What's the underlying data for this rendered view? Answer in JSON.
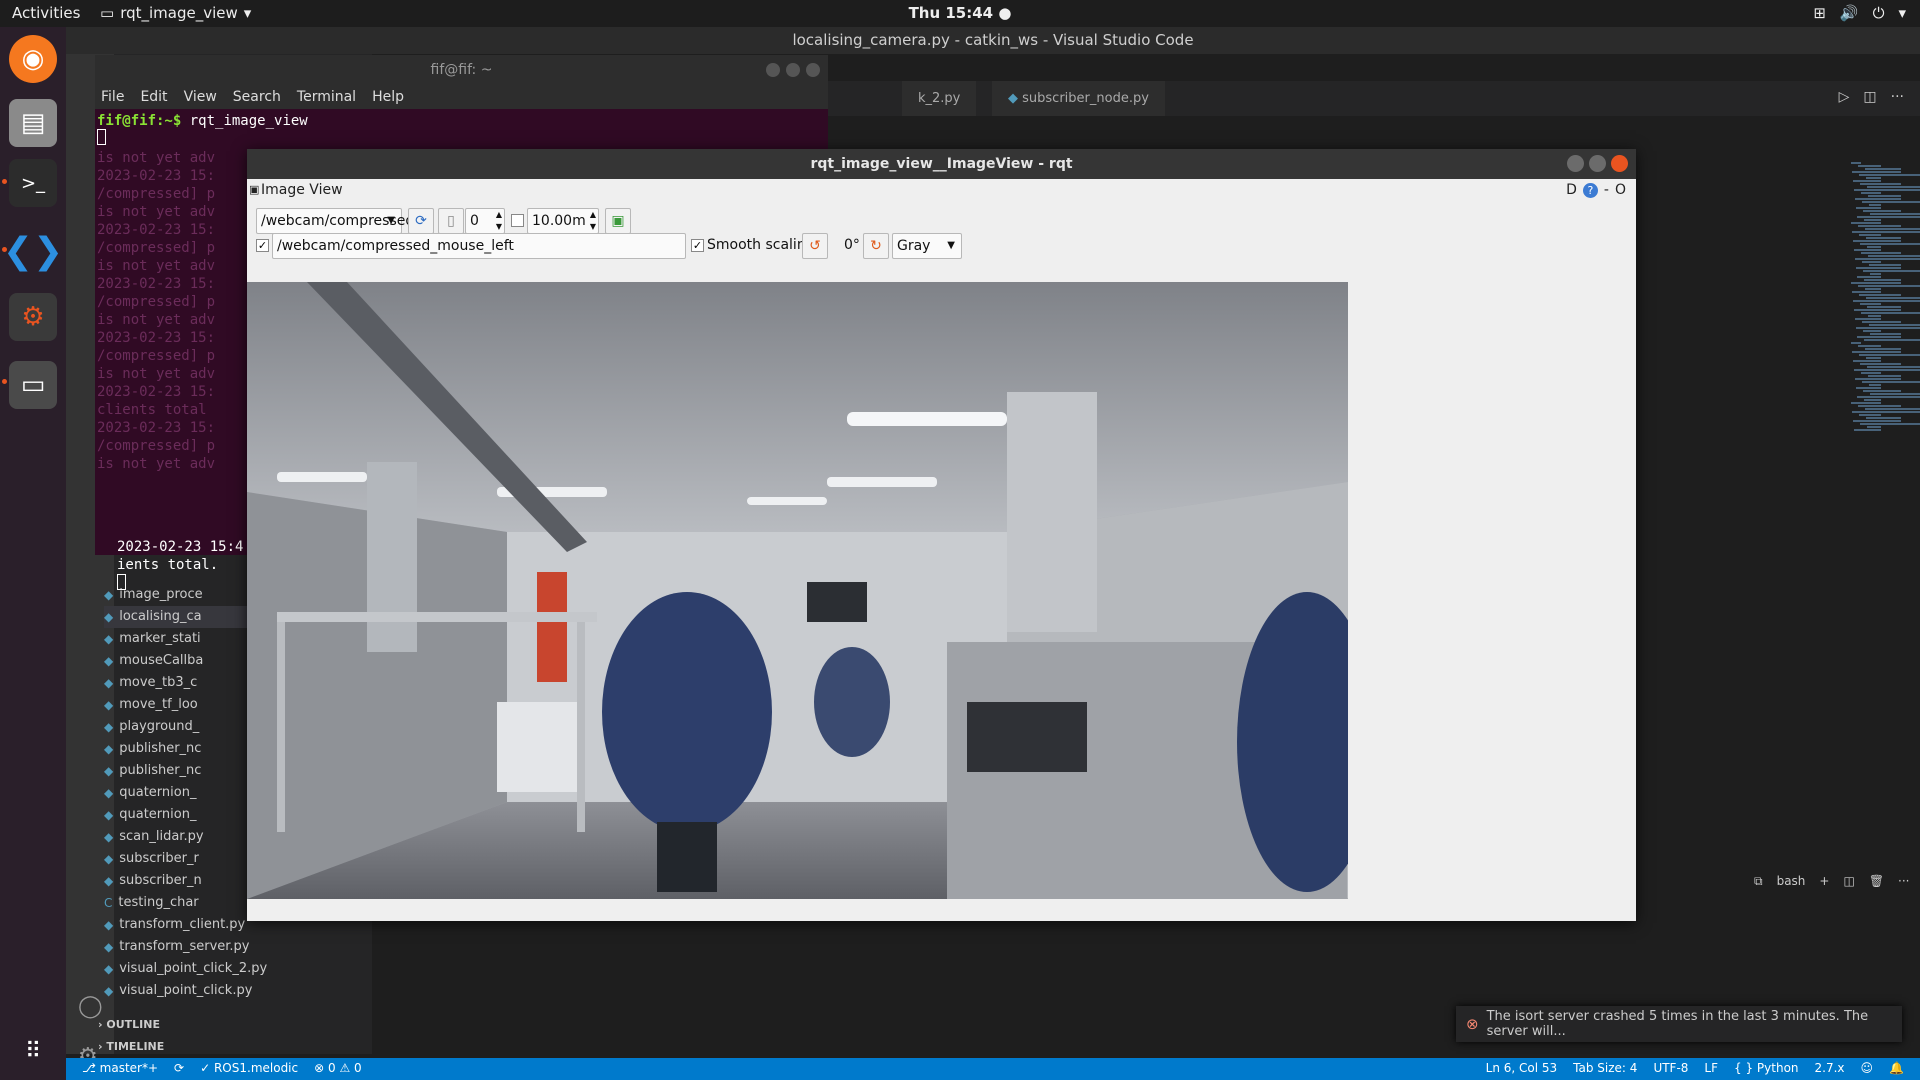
{
  "topbar": {
    "activities": "Activities",
    "app_menu": "rqt_image_view",
    "clock": "Thu 15:44"
  },
  "vscode": {
    "title": "localising_camera.py - catkin_ws - Visual Studio Code",
    "tabs": [
      "k_2.py",
      "subscriber_node.py"
    ],
    "files": [
      "image_proce",
      "localising_ca",
      "marker_stati",
      "mouseCallba",
      "move_tb3_c",
      "move_tf_loo",
      "playground_",
      "publisher_nc",
      "publisher_nc",
      "quaternion_",
      "quaternion_",
      "scan_lidar.py",
      "subscriber_r",
      "subscriber_n",
      "testing_char",
      "transform_client.py",
      "transform_server.py",
      "visual_point_click_2.py",
      "visual_point_click.py"
    ],
    "outline": "OUTLINE",
    "timeline": "TIMELINE",
    "terminal_shell": "bash",
    "notification": "The isort server crashed 5 times in the last 3 minutes. The server will...",
    "status_left": [
      "master*+",
      "ROS1.melodic",
      "⊗ 0 ⚠ 0"
    ],
    "status_right": [
      "Ln 6, Col 53",
      "Tab Size: 4",
      "UTF-8",
      "LF",
      "Python",
      "2.7.x"
    ]
  },
  "terminal": {
    "title": "fif@fif: ~",
    "menu": [
      "File",
      "Edit",
      "View",
      "Search",
      "Terminal",
      "Help"
    ],
    "prompt": "fif@fif:~$",
    "command": "rqt_image_view",
    "ghost_lines": [
      "is not yet adv",
      "2023-02-23 15:",
      "/compressed] p",
      "is not yet adv",
      "2023-02-23 15:",
      "/compressed] p",
      "is not yet adv",
      "2023-02-23 15:",
      "/compressed] p",
      "is not yet adv",
      "2023-02-23 15:",
      "/compressed] p",
      "is not yet adv",
      "2023-02-23 15:",
      "clients total",
      "2023-02-23 15:",
      "/compressed] p",
      "is not yet adv"
    ],
    "tail_lines": [
      "2023-02-23 15:4",
      "ients total."
    ]
  },
  "rqt": {
    "title": "rqt_image_view__ImageView - rqt",
    "plugin_title": "Image View",
    "plugin_controls": "D",
    "topic": "/webcam/compressed",
    "spin_value": "0",
    "duration": "10.00m",
    "mouse_topic": "/webcam/compressed_mouse_left",
    "smooth_label": "Smooth scaling",
    "rotation": "0°",
    "colormap": "Gray"
  }
}
